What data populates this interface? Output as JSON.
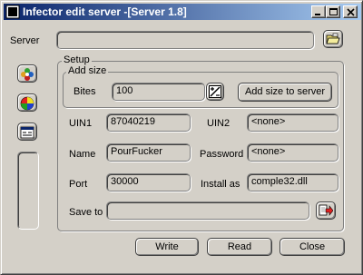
{
  "window": {
    "title": "Infector edit server -[Server 1.8]",
    "controls": {
      "minimize": "minimize-icon",
      "maximize": "maximize-icon",
      "close": "close-icon"
    }
  },
  "server": {
    "label": "Server",
    "value": ""
  },
  "setup": {
    "label": "Setup",
    "add_size": {
      "label": "Add size",
      "bites_label": "Bites",
      "bites_value": "100",
      "button_label": "Add size to server"
    },
    "fields": {
      "uin1": {
        "label": "UIN1",
        "value": "87040219"
      },
      "uin2": {
        "label": "UIN2",
        "value": "<none>"
      },
      "name": {
        "label": "Name",
        "value": "PourFucker"
      },
      "password": {
        "label": "Password",
        "value": "<none>"
      },
      "port": {
        "label": "Port",
        "value": "30000"
      },
      "install_as": {
        "label": "Install as",
        "value": "comple32.dll"
      },
      "save_to": {
        "label": "Save to",
        "value": ""
      }
    }
  },
  "buttons": {
    "write": "Write",
    "read": "Read",
    "close": "Close"
  },
  "icons": [
    "folder-open-icon",
    "flower-icon",
    "color-circle-icon",
    "window-icon",
    "calculator-icon",
    "save-arrow-icon"
  ]
}
